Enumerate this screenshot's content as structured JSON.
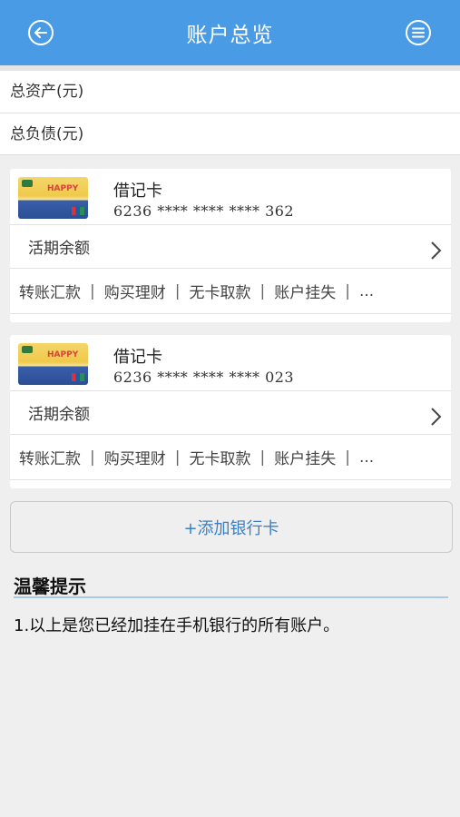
{
  "header": {
    "title": "账户总览",
    "back_icon": "back-arrow-icon",
    "menu_icon": "menu-icon",
    "color": "#4a9be6"
  },
  "summary": {
    "total_assets_label": "总资产(元)",
    "total_liabilities_label": "总负债(元)"
  },
  "cards": [
    {
      "name": "借记卡",
      "number": "6236 **** **** **** 362",
      "balance_label": "活期余额",
      "actions": [
        "转账汇款",
        "购买理财",
        "无卡取款",
        "账户挂失",
        "..."
      ]
    },
    {
      "name": "借记卡",
      "number": "6236 **** **** **** 023",
      "balance_label": "活期余额",
      "actions": [
        "转账汇款",
        "购买理财",
        "无卡取款",
        "账户挂失",
        "..."
      ]
    }
  ],
  "add_card": {
    "label": "+添加银行卡"
  },
  "tips": {
    "title": "温馨提示",
    "text": "1.以上是您已经加挂在手机银行的所有账户。"
  }
}
